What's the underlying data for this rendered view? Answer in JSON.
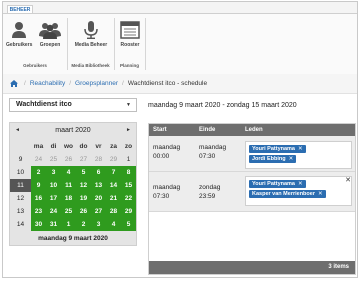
{
  "ribbon": {
    "tab": "BEHEER",
    "buttons": [
      {
        "label": "Gebruikers",
        "icon": "user-icon"
      },
      {
        "label": "Groepen",
        "icon": "group-icon"
      },
      {
        "label": "Media Beheer",
        "icon": "microphone-icon"
      },
      {
        "label": "Rooster",
        "icon": "calendar-icon"
      }
    ],
    "groups": [
      "Gebruikers",
      "Media Bibliotheek",
      "Planning"
    ]
  },
  "breadcrumb": {
    "items": [
      "Reachability",
      "Groepsplanner",
      "Wachtdienst itco - schedule"
    ]
  },
  "schedule_select": {
    "value": "Wachtdienst itco"
  },
  "calendar": {
    "month_label": "maart 2020",
    "prev": "◄",
    "next": "►",
    "days_of_week": [
      "ma",
      "di",
      "wo",
      "do",
      "vr",
      "za",
      "zo"
    ],
    "weeks": [
      {
        "week": "9",
        "days": [
          "24",
          "25",
          "26",
          "27",
          "28",
          "29",
          "1"
        ]
      },
      {
        "week": "10",
        "days": [
          "2",
          "3",
          "4",
          "5",
          "6",
          "7",
          "8"
        ]
      },
      {
        "week": "11",
        "days": [
          "9",
          "10",
          "11",
          "12",
          "13",
          "14",
          "15"
        ]
      },
      {
        "week": "12",
        "days": [
          "16",
          "17",
          "18",
          "19",
          "20",
          "21",
          "22"
        ]
      },
      {
        "week": "13",
        "days": [
          "23",
          "24",
          "25",
          "26",
          "27",
          "28",
          "29"
        ]
      },
      {
        "week": "14",
        "days": [
          "30",
          "31",
          "1",
          "2",
          "3",
          "4",
          "5"
        ]
      }
    ],
    "selected_date_label": "maandag 9 maart 2020"
  },
  "range_label": "maandag 9 maart 2020 - zondag 15 maart 2020",
  "schedule": {
    "columns": [
      "Start",
      "Einde",
      "Leden"
    ],
    "rows": [
      {
        "start_day": "maandag",
        "start_time": "00:00",
        "end_day": "maandag",
        "end_time": "07:30",
        "members": [
          "Youri Pattynama",
          "Jordi Ebbing"
        ]
      },
      {
        "start_day": "maandag",
        "start_time": "07:30",
        "end_day": "zondag",
        "end_time": "23:59",
        "members": [
          "Youri Pattynama",
          "Kasper van Merrienboer"
        ]
      }
    ],
    "footer": "3 items"
  },
  "colors": {
    "accent": "#2b6db1",
    "calendar_green": "#2f9b1e",
    "header_gray": "#6e6e6e"
  }
}
